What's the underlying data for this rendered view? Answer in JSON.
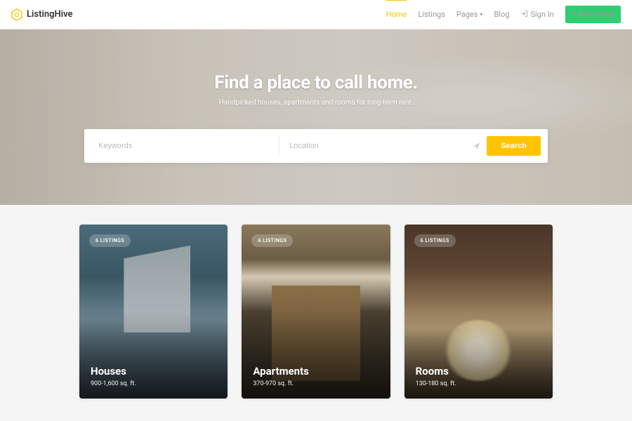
{
  "brand": "ListingHive",
  "nav": {
    "home": "Home",
    "listings": "Listings",
    "pages": "Pages",
    "blog": "Blog",
    "signin": "Sign In",
    "add": "Add Listing"
  },
  "hero": {
    "title": "Find a place to call home.",
    "subtitle": "Handpicked houses, apartments and rooms for long-term rent."
  },
  "search": {
    "keywords_placeholder": "Keywords",
    "location_placeholder": "Location",
    "button": "Search"
  },
  "cards": [
    {
      "badge": "6 LISTINGS",
      "title": "Houses",
      "meta": "900-1,600 sq. ft."
    },
    {
      "badge": "6 LISTINGS",
      "title": "Apartments",
      "meta": "370-970 sq. ft."
    },
    {
      "badge": "6 LISTINGS",
      "title": "Rooms",
      "meta": "130-180 sq. ft."
    }
  ]
}
